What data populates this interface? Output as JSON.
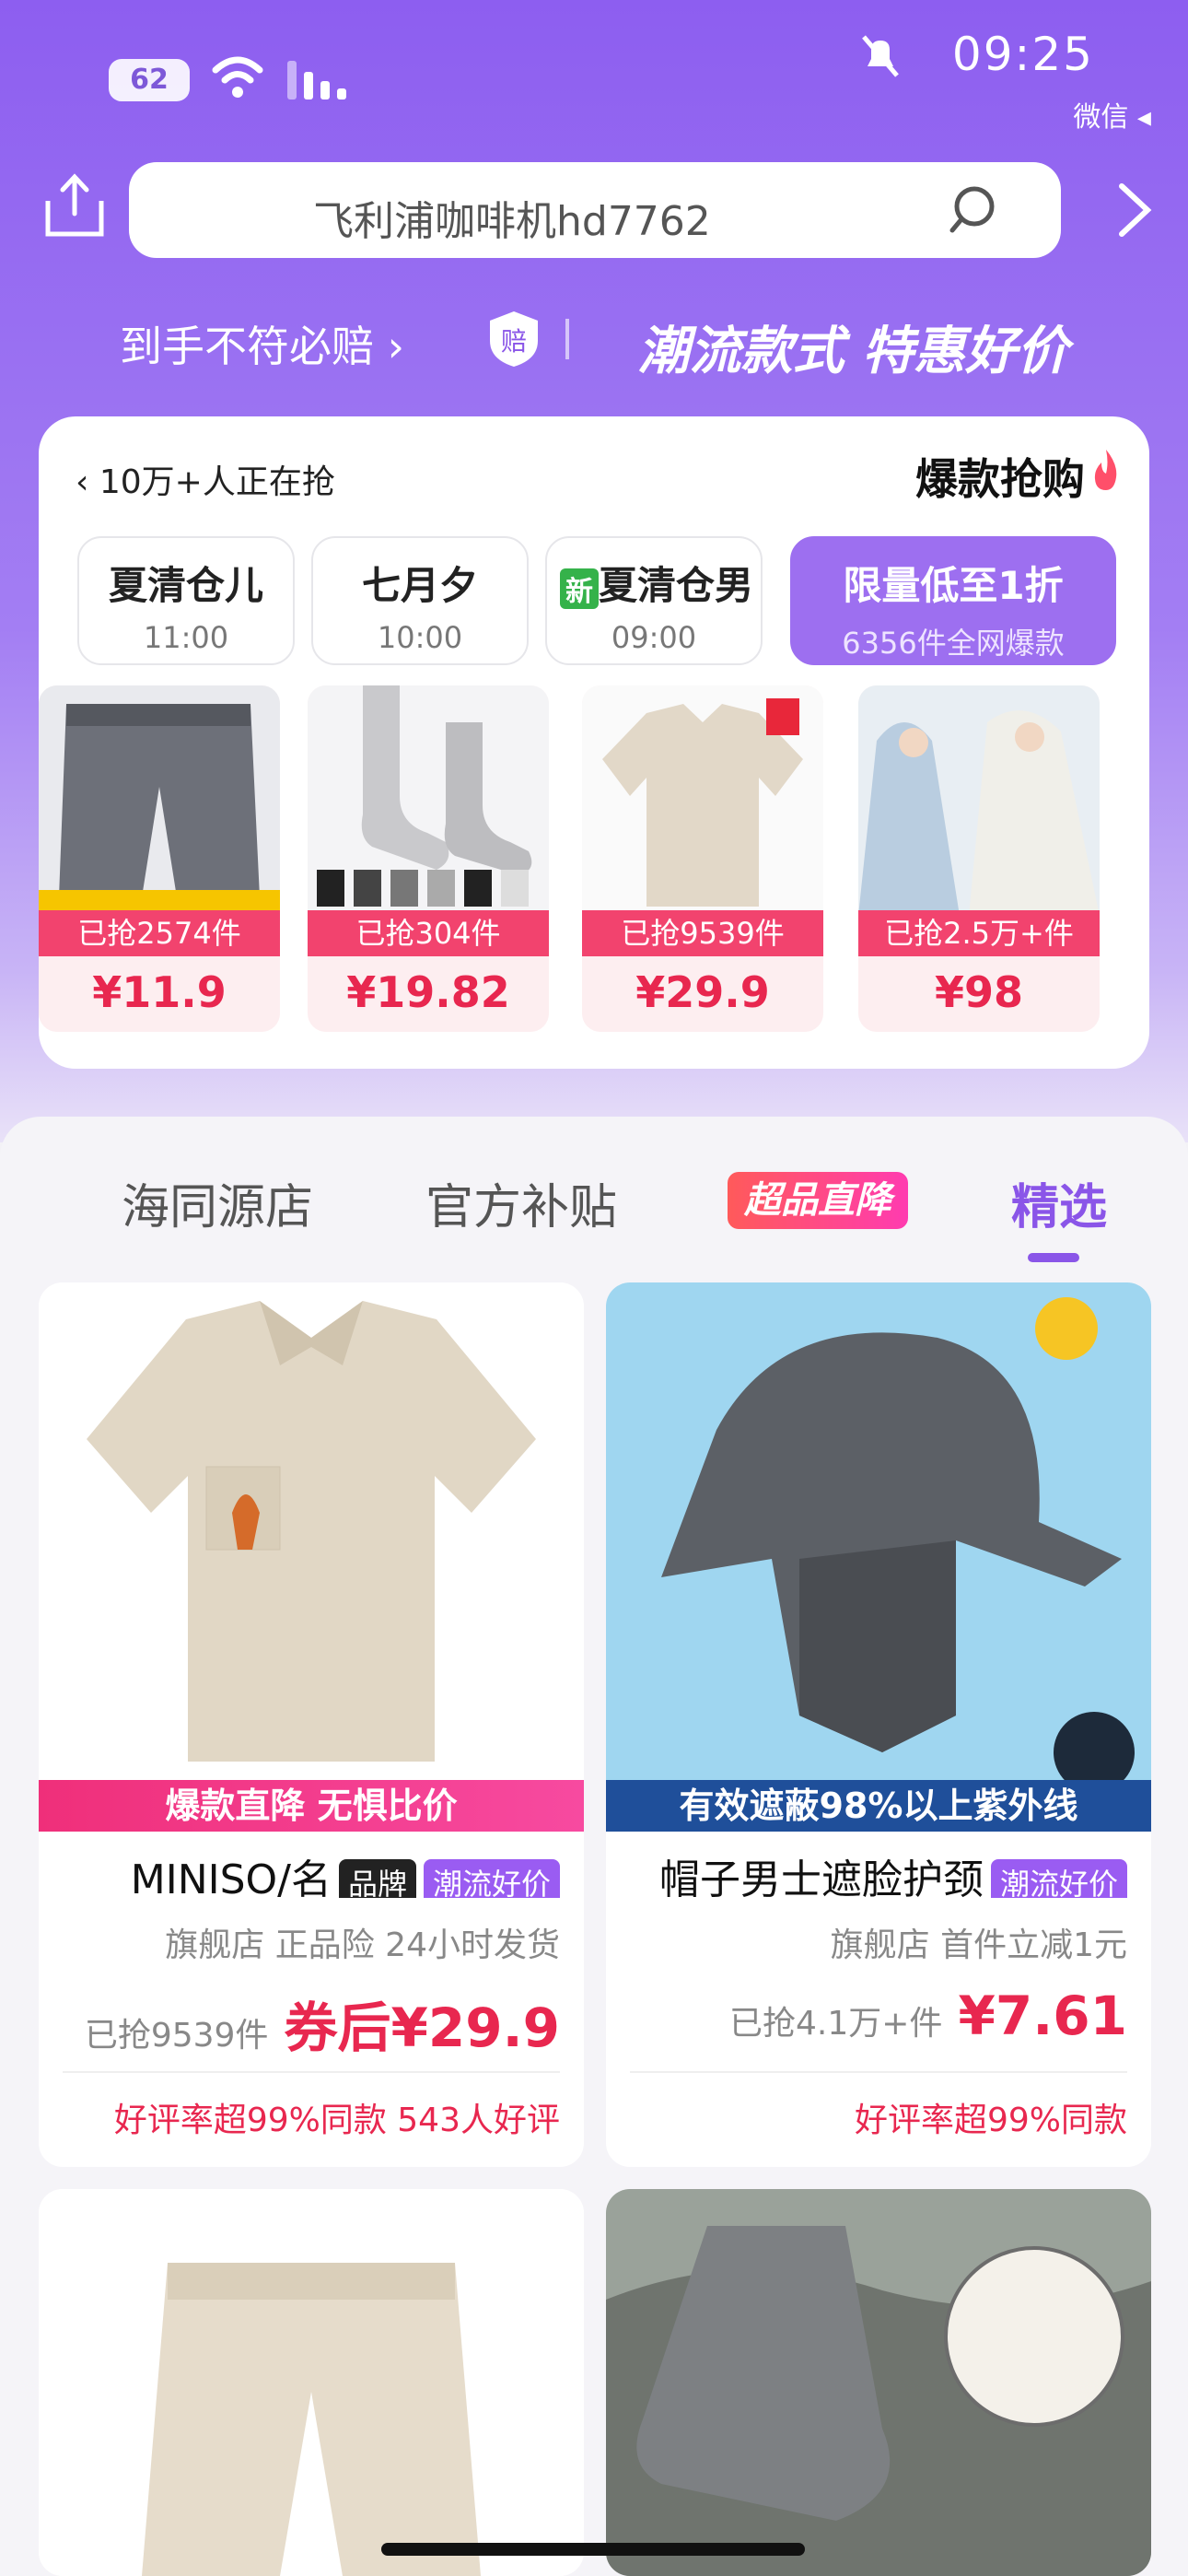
{
  "status": {
    "time": "09:25",
    "battery": "62",
    "back_app": "微信 ◂"
  },
  "search": {
    "query": "飞利浦咖啡机hd7762"
  },
  "banner": {
    "left_text": "到手不符必赔 ›",
    "badge": "赔",
    "right_text": "潮流款式 特惠好价"
  },
  "flash": {
    "title": "爆款抢购",
    "more": "‹ 10万+人正在抢",
    "time_tabs": [
      {
        "label": "限量低至1折",
        "sub": "6356件全网爆款"
      },
      {
        "label": "夏清仓男",
        "tag": "新",
        "sub": "09:00"
      },
      {
        "label": "七月夕",
        "sub": "10:00"
      },
      {
        "label": "夏清仓儿",
        "sub": "11:00"
      }
    ],
    "products": [
      {
        "sold": "已抢2.5万+件",
        "price": "¥98"
      },
      {
        "sold": "已抢9539件",
        "price": "¥29.9"
      },
      {
        "sold": "已抢304件",
        "price": "¥19.82"
      },
      {
        "sold": "已抢2574件",
        "price": "¥11.9"
      }
    ]
  },
  "feed_tabs": {
    "items": [
      "精选",
      "官方补贴",
      "海同源店"
    ],
    "promo": "超品直降"
  },
  "goods": [
    {
      "title": "帽子男士遮脸护颈",
      "tag": "潮流好价",
      "caption": "有效遮蔽98%以上紫外线",
      "sub": "旗舰店  首件立减1元",
      "price": "¥7.61",
      "sold": "已抢4.1万+件",
      "rate": "好评率超99%同款"
    },
    {
      "title": "MINISO/名",
      "tag": "潮流好价",
      "tag2": "品牌",
      "caption": "爆款直降 无惧比价",
      "sub": "旗舰店  正品险  24小时发货",
      "price": "券后¥29.9",
      "sold": "已抢9539件",
      "rate": "好评率超99%同款  543人好评"
    }
  ],
  "colors": {
    "accent": "#8a55e8",
    "price": "#e8274f",
    "sold_bar": "#f2436e"
  }
}
